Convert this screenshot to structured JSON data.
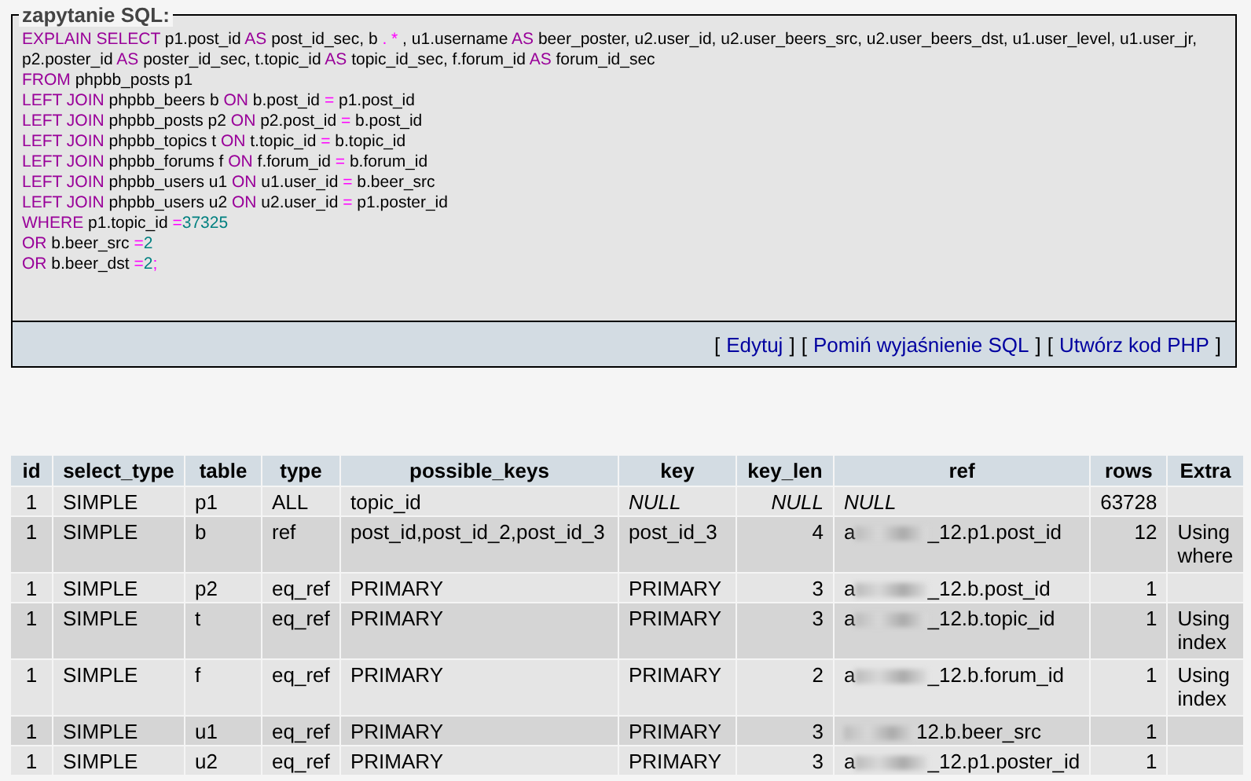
{
  "sql_box": {
    "legend": "zapytanie SQL:",
    "lines": [
      [
        {
          "kind": "kw",
          "text": "EXPLAIN SELECT"
        },
        {
          "kind": "t",
          "text": " p1.post_id "
        },
        {
          "kind": "kw",
          "text": "AS"
        },
        {
          "kind": "t",
          "text": " post_id_sec, b "
        },
        {
          "kind": "op",
          "text": ". *"
        },
        {
          "kind": "t",
          "text": " , u1.username "
        },
        {
          "kind": "kw",
          "text": "AS"
        },
        {
          "kind": "t",
          "text": " beer_poster, u2.user_id, u2.user_beers_src, u2.user_beers_dst, u1.user_level, u1.user_jr,"
        }
      ],
      [
        {
          "kind": "t",
          "text": "p2.poster_id "
        },
        {
          "kind": "kw",
          "text": "AS"
        },
        {
          "kind": "t",
          "text": " poster_id_sec, t.topic_id "
        },
        {
          "kind": "kw",
          "text": "AS"
        },
        {
          "kind": "t",
          "text": " topic_id_sec, f.forum_id "
        },
        {
          "kind": "kw",
          "text": "AS"
        },
        {
          "kind": "t",
          "text": " forum_id_sec"
        }
      ],
      [
        {
          "kind": "kw",
          "text": "FROM"
        },
        {
          "kind": "t",
          "text": " phpbb_posts p1"
        }
      ],
      [
        {
          "kind": "kw",
          "text": "LEFT JOIN"
        },
        {
          "kind": "t",
          "text": " phpbb_beers b "
        },
        {
          "kind": "kw",
          "text": "ON"
        },
        {
          "kind": "t",
          "text": " b.post_id "
        },
        {
          "kind": "op",
          "text": "="
        },
        {
          "kind": "t",
          "text": " p1.post_id"
        }
      ],
      [
        {
          "kind": "kw",
          "text": "LEFT JOIN"
        },
        {
          "kind": "t",
          "text": " phpbb_posts p2 "
        },
        {
          "kind": "kw",
          "text": "ON"
        },
        {
          "kind": "t",
          "text": " p2.post_id "
        },
        {
          "kind": "op",
          "text": "="
        },
        {
          "kind": "t",
          "text": " b.post_id"
        }
      ],
      [
        {
          "kind": "kw",
          "text": "LEFT JOIN"
        },
        {
          "kind": "t",
          "text": " phpbb_topics t "
        },
        {
          "kind": "kw",
          "text": "ON"
        },
        {
          "kind": "t",
          "text": " t.topic_id "
        },
        {
          "kind": "op",
          "text": "="
        },
        {
          "kind": "t",
          "text": " b.topic_id"
        }
      ],
      [
        {
          "kind": "kw",
          "text": "LEFT JOIN"
        },
        {
          "kind": "t",
          "text": " phpbb_forums f "
        },
        {
          "kind": "kw",
          "text": "ON"
        },
        {
          "kind": "t",
          "text": " f.forum_id "
        },
        {
          "kind": "op",
          "text": "="
        },
        {
          "kind": "t",
          "text": " b.forum_id"
        }
      ],
      [
        {
          "kind": "kw",
          "text": "LEFT JOIN"
        },
        {
          "kind": "t",
          "text": " phpbb_users u1 "
        },
        {
          "kind": "kw",
          "text": "ON"
        },
        {
          "kind": "t",
          "text": " u1.user_id "
        },
        {
          "kind": "op",
          "text": "="
        },
        {
          "kind": "t",
          "text": " b.beer_src"
        }
      ],
      [
        {
          "kind": "kw",
          "text": "LEFT JOIN"
        },
        {
          "kind": "t",
          "text": " phpbb_users u2 "
        },
        {
          "kind": "kw",
          "text": "ON"
        },
        {
          "kind": "t",
          "text": " u2.user_id "
        },
        {
          "kind": "op",
          "text": "="
        },
        {
          "kind": "t",
          "text": " p1.poster_id"
        }
      ],
      [
        {
          "kind": "kw",
          "text": "WHERE"
        },
        {
          "kind": "t",
          "text": " p1.topic_id "
        },
        {
          "kind": "op",
          "text": "="
        },
        {
          "kind": "num",
          "text": "37325"
        }
      ],
      [
        {
          "kind": "kw",
          "text": "OR"
        },
        {
          "kind": "t",
          "text": " b.beer_src "
        },
        {
          "kind": "op",
          "text": "="
        },
        {
          "kind": "num",
          "text": "2"
        }
      ],
      [
        {
          "kind": "kw",
          "text": "OR"
        },
        {
          "kind": "t",
          "text": " b.beer_dst "
        },
        {
          "kind": "op",
          "text": "="
        },
        {
          "kind": "num",
          "text": "2"
        },
        {
          "kind": "op",
          "text": ";"
        }
      ]
    ],
    "footer": {
      "bracket_open": "[",
      "bracket_close": "]",
      "links": [
        "Edytuj",
        "Pomiń wyjaśnienie SQL",
        "Utwórz kod PHP"
      ]
    }
  },
  "table": {
    "columns": [
      "id",
      "select_type",
      "table",
      "type",
      "possible_keys",
      "key",
      "key_len",
      "ref",
      "rows",
      "Extra"
    ],
    "rows": [
      [
        "1",
        "SIMPLE",
        "p1",
        "ALL",
        "topic_id",
        {
          "text": "NULL",
          "italic": true
        },
        {
          "text": "NULL",
          "italic": true
        },
        {
          "text": "NULL",
          "italic": true
        },
        "63728",
        null
      ],
      [
        "1",
        "SIMPLE",
        "b",
        "ref",
        "post_id,post_id_2,post_id_3",
        "post_id_3",
        "4",
        {
          "start": "a",
          "redacted": true,
          "end": "_12.p1.post_id"
        },
        "12",
        "Using where"
      ],
      [
        "1",
        "SIMPLE",
        "p2",
        "eq_ref",
        "PRIMARY",
        "PRIMARY",
        "3",
        {
          "start": "a",
          "redacted": true,
          "end": "_12.b.post_id"
        },
        "1",
        null
      ],
      [
        "1",
        "SIMPLE",
        "t",
        "eq_ref",
        "PRIMARY",
        "PRIMARY",
        "3",
        {
          "start": "a",
          "redacted": true,
          "end": "_12.b.topic_id"
        },
        "1",
        "Using index"
      ],
      [
        "1",
        "SIMPLE",
        "f",
        "eq_ref",
        "PRIMARY",
        "PRIMARY",
        "2",
        {
          "start": "a",
          "redacted": true,
          "end": "_12.b.forum_id"
        },
        "1",
        "Using index"
      ],
      [
        "1",
        "SIMPLE",
        "u1",
        "eq_ref",
        "PRIMARY",
        "PRIMARY",
        "3",
        {
          "redacted": true,
          "end": "12.b.beer_src"
        },
        "1",
        null
      ],
      [
        "1",
        "SIMPLE",
        "u2",
        "eq_ref",
        "PRIMARY",
        "PRIMARY",
        "3",
        {
          "start": "a",
          "redacted": true,
          "end": "_12.p1.poster_id"
        },
        "1",
        null
      ]
    ]
  }
}
